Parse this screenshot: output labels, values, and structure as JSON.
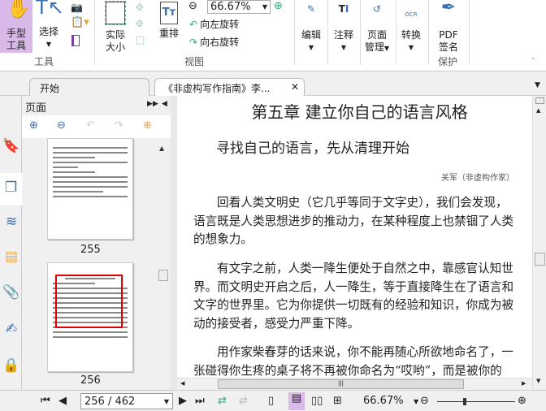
{
  "ribbon": {
    "hand_tool": "手型\n工具",
    "hand_l1": "手型",
    "hand_l2": "工具",
    "select": "选择",
    "actual_size_l1": "实际",
    "actual_size_l2": "大小",
    "reflow": "重排",
    "zoom_value": "66.67%",
    "rotate_left": "向左旋转",
    "rotate_right": "向右旋转",
    "edit": "编辑",
    "annotate": "注释",
    "page_l1": "页面",
    "page_l2": "管理",
    "convert": "转换",
    "pdf_sign_l1": "PDF",
    "pdf_sign_l2": "签名",
    "group_tools": "工具",
    "group_view": "视图",
    "group_protect": "保护"
  },
  "tabs": [
    {
      "label": "开始"
    },
    {
      "label": "《非虚构写作指南》李..."
    }
  ],
  "panel": {
    "title": "页面",
    "thumbs": [
      {
        "page": "255"
      },
      {
        "page": "256"
      }
    ]
  },
  "document": {
    "title": "第五章  建立你自己的语言风格",
    "subtitle": "寻找自己的语言，先从清理开始",
    "author": "关军（非虚构作家）",
    "paragraphs": [
      "回看人类文明史（它几乎等同于文字史），我们会发现，语言既是人类思想进步的推动力，在某种程度上也禁锢了人类的想象力。",
      "有文字之前，人类一降生便处于自然之中，靠感官认知世界。而文明史开启之后，人一降生，等于直接降生在了语言和文字的世界里。它为你提供一切既有的经验和知识，你成为被动的接受者，感受力严重下降。",
      "用作家柴春芽的话来说，你不能再随心所欲地命名了，一张碰得你生疼的桌子将不再被你命名为“哎哟”，而是被你的"
    ]
  },
  "status": {
    "page_field": "256 / 462",
    "zoom": "66.67%"
  },
  "colors": {
    "accent": "#d9b9e8",
    "highlight_red": "#e00000"
  }
}
